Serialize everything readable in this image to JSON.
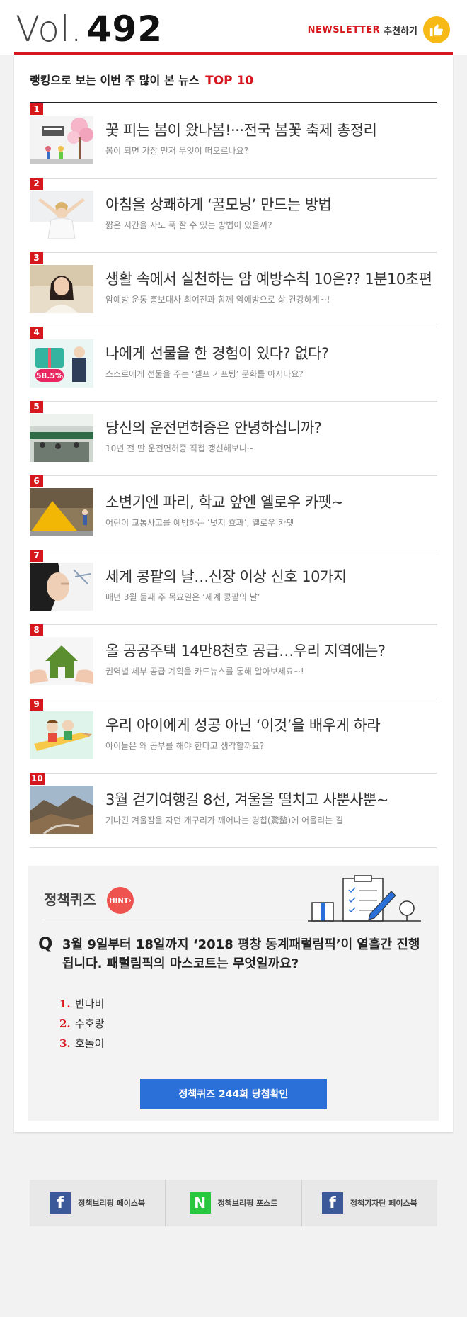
{
  "header": {
    "vol_label": "Vol.",
    "vol_number": "492",
    "newsletter_label": "NEWSLETTER",
    "recommend_label": "추천하기",
    "thumb_icon": "thumbs-up-icon"
  },
  "colors": {
    "accent_red": "#d6171e",
    "button_blue": "#2b70d8",
    "hint_red": "#ef5350",
    "thumb_yellow": "#f7b916"
  },
  "ranking": {
    "title": "랭킹으로 보는 이번 주 많이 본 뉴스",
    "title_highlight": "TOP 10",
    "items": [
      {
        "num": "1",
        "title": "꽃 피는 봄이 왔나봄!···전국 봄꽃 축제 총정리",
        "sub": "봄이 되면 가장 먼저 무엇이 떠오르나요?"
      },
      {
        "num": "2",
        "title": "아침을 상쾌하게 ‘꿀모닝’ 만드는 방법",
        "sub": "짧은 시간을 자도 푹 잘 수 있는 방법이 있을까?"
      },
      {
        "num": "3",
        "title": "생활 속에서 실천하는 암 예방수칙 10은?? 1분10초편",
        "sub": "암예방 운동 홍보대사 최여진과 함께 암예방으로 삶 건강하게~!"
      },
      {
        "num": "4",
        "title": "나에게 선물을 한 경험이 있다? 없다?",
        "sub": "스스로에게 선물을 주는 ‘셀프 기프팅’ 문화를 아시나요?",
        "badge_text": "58.5%"
      },
      {
        "num": "5",
        "title": "당신의 운전면허증은 안녕하십니까?",
        "sub": "10년 전 딴 운전면허증 직접 갱신해보니~"
      },
      {
        "num": "6",
        "title": "소변기엔 파리, 학교 앞엔 옐로우 카펫~",
        "sub": "어린이 교통사고를 예방하는 ‘넛지 효과’, 옐로우 카펫"
      },
      {
        "num": "7",
        "title": "세계 콩팥의 날…신장 이상 신호 10가지",
        "sub": "매년 3월 둘째 주 목요일은  ‘세계 콩팥의 날’"
      },
      {
        "num": "8",
        "title": "올 공공주택 14만8천호 공급…우리 지역에는?",
        "sub": "권역별 세부 공급 계획을 카드뉴스를 통해 알아보세요~!"
      },
      {
        "num": "9",
        "title": "우리 아이에게 성공 아닌 ‘이것’을 배우게 하라",
        "sub": "아이들은 왜 공부를 해야 한다고 생각할까요?"
      },
      {
        "num": "10",
        "title": "3월 걷기여행길 8선, 겨울을 떨치고 사뿐사뿐~",
        "sub": "기나긴 겨울잠을 자던 개구리가 깨어나는 경칩(驚蟄)에 어울리는 길"
      }
    ]
  },
  "quiz": {
    "title": "정책퀴즈",
    "hint_label": "HINT",
    "q_mark": "Q",
    "question": "3월 9일부터 18일까지 ‘2018 평창 동계패럴림픽’이 열흘간 진행됩니다. 패럴림픽의 마스코트는 무엇일까요?",
    "options": [
      {
        "num": "1.",
        "text": "반다비"
      },
      {
        "num": "2.",
        "text": "수호랑"
      },
      {
        "num": "3.",
        "text": "호돌이"
      }
    ],
    "button_label": "정책퀴즈 244회 당첨확인"
  },
  "footer": {
    "links": [
      {
        "icon": "facebook-icon",
        "glyph": "f",
        "label": "정책브리핑 페이스북"
      },
      {
        "icon": "naver-post-icon",
        "glyph": "N",
        "label": "정책브리핑 포스트"
      },
      {
        "icon": "facebook-icon",
        "glyph": "f",
        "label": "정책기자단 페이스북"
      }
    ]
  }
}
